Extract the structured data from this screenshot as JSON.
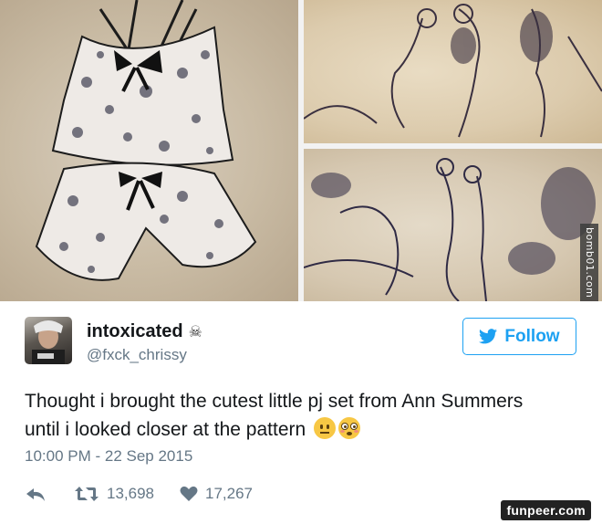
{
  "images": {
    "side_watermark": "bomb01.com"
  },
  "tweet": {
    "display_name": "intoxicated",
    "name_emoji": "☠",
    "handle": "@fxck_chrissy",
    "follow_label": "Follow",
    "text_line1": "Thought i brought the cutest little pj set from Ann Summers",
    "text_line2": "until i looked closer at the pattern",
    "timestamp": "10:00 PM - 22 Sep 2015",
    "retweets": "13,698",
    "likes": "17,267"
  },
  "footer": {
    "watermark": "funpeer.com"
  },
  "colors": {
    "accent": "#1da1f2",
    "meta": "#657786",
    "text": "#14171a"
  },
  "icons": [
    "skull-icon",
    "twitter-bird-icon",
    "reply-icon",
    "retweet-icon",
    "heart-icon"
  ]
}
